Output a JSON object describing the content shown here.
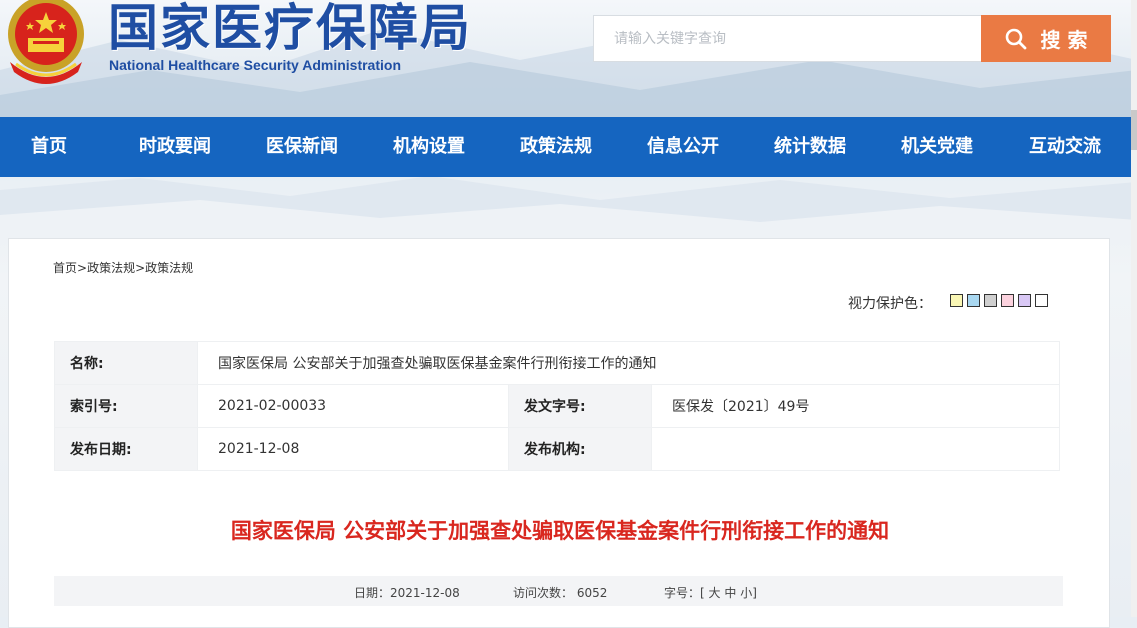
{
  "header": {
    "title_cn": "国家医疗保障局",
    "title_en": "National Healthcare Security Administration",
    "emblem_icon": "national-emblem-icon"
  },
  "search": {
    "placeholder": "请输入关键字查询",
    "button_label": "搜 索",
    "accent": "#ea7a44"
  },
  "nav": {
    "bg": "#1565c0",
    "items": [
      {
        "label": "首页"
      },
      {
        "label": "时政要闻"
      },
      {
        "label": "医保新闻"
      },
      {
        "label": "机构设置"
      },
      {
        "label": "政策法规"
      },
      {
        "label": "信息公开"
      },
      {
        "label": "统计数据"
      },
      {
        "label": "机关党建"
      },
      {
        "label": "互动交流"
      }
    ]
  },
  "breadcrumb": {
    "items": [
      "首页",
      "政策法规",
      "政策法规"
    ],
    "sep": ">"
  },
  "eye_protection": {
    "label": "视力保护色：",
    "colors": [
      "#faf7b5",
      "#a9d8f1",
      "#cfcfcf",
      "#fcd2de",
      "#d9c8f5",
      "#ffffff"
    ]
  },
  "meta": {
    "name_label": "名称:",
    "name_value": "国家医保局 公安部关于加强查处骗取医保基金案件行刑衔接工作的通知",
    "index_label": "索引号:",
    "index_value": "2021-02-00033",
    "docno_label": "发文字号:",
    "docno_value": "医保发〔2021〕49号",
    "date_label": "发布日期:",
    "date_value": "2021-12-08",
    "org_label": "发布机构:",
    "org_value": ""
  },
  "article": {
    "title": "国家医保局 公安部关于加强查处骗取医保基金案件行刑衔接工作的通知",
    "title_color": "#d9271f"
  },
  "info_bar": {
    "date": "日期：2021-12-08",
    "visits": "访问次数： 6052",
    "font_label": "字号：[",
    "font_large": "大",
    "font_medium": "中",
    "font_small": "小",
    "font_end": "]"
  }
}
